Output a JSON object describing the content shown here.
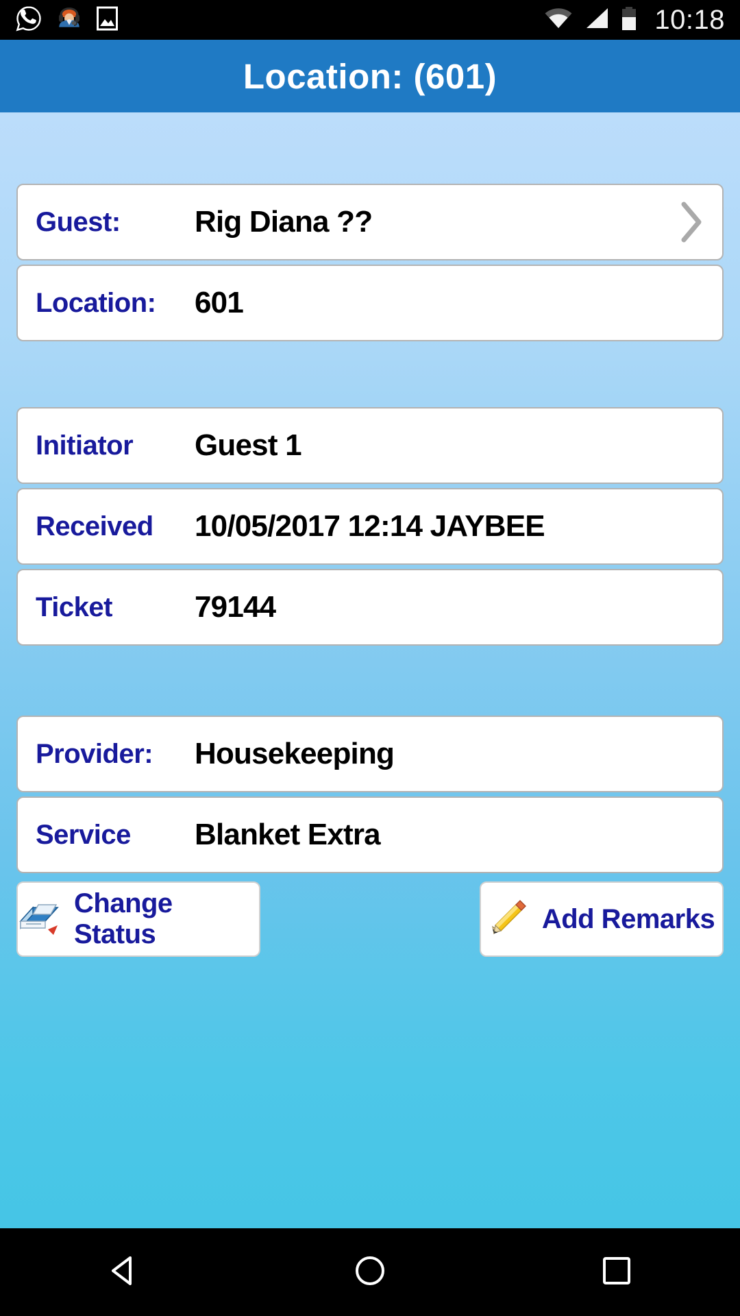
{
  "status_bar": {
    "icons_left": [
      "whatsapp-icon",
      "support-agent-icon",
      "gallery-image-icon"
    ],
    "icons_right": [
      "wifi-icon",
      "cellular-signal-icon",
      "battery-icon"
    ],
    "clock": "10:18"
  },
  "app_bar": {
    "title": "Location: (601)"
  },
  "groups": [
    {
      "rows": [
        {
          "label": "Guest:",
          "value": "Rig Diana ??",
          "chevron": true
        },
        {
          "label": "Location:",
          "value": "601",
          "chevron": false
        }
      ]
    },
    {
      "rows": [
        {
          "label": "Initiator",
          "value": "Guest 1",
          "chevron": false
        },
        {
          "label": "Received",
          "value": "10/05/2017 12:14 JAYBEE",
          "chevron": false
        },
        {
          "label": "Ticket",
          "value": "79144",
          "chevron": false
        }
      ]
    },
    {
      "rows": [
        {
          "label": "Provider:",
          "value": "Housekeeping",
          "chevron": false
        },
        {
          "label": "Service",
          "value": "Blanket Extra",
          "chevron": false
        }
      ]
    }
  ],
  "actions": [
    {
      "label": "Change Status",
      "icon": "change-status-icon"
    },
    {
      "label": "Add Remarks",
      "icon": "pencil-icon"
    }
  ],
  "nav_bar": {
    "back": "back-triangle-icon",
    "home": "home-circle-icon",
    "recents": "recents-square-icon"
  },
  "colors": {
    "app_bar": "#1f7ac4",
    "label": "#181a9c",
    "value": "#000000",
    "background_top": "#bcddfb",
    "background_bottom": "#45c5e6",
    "card": "#ffffff",
    "card_border": "#b3b3b3",
    "status_bar": "#000000"
  }
}
